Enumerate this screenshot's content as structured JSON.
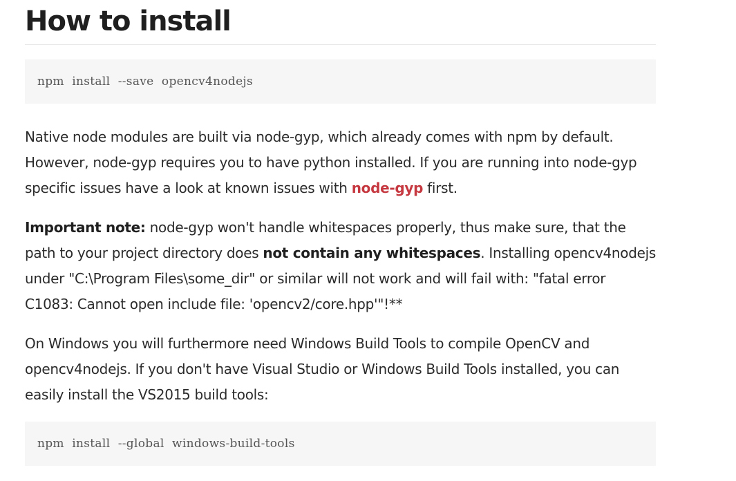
{
  "heading": "How to install",
  "code_blocks": [
    "npm  install  --save  opencv4nodejs",
    "npm  install  --global  windows-build-tools"
  ],
  "paragraphs": {
    "p1": {
      "before_link": "Native node modules are built via node-gyp, which already comes with npm by default. However, node-gyp requires you to have python installed. If you are running into node-gyp specific issues have a look at known issues with ",
      "link": "node-gyp",
      "after_link": " first."
    },
    "p2": {
      "bold_label": "Important note:",
      "text_1": " node-gyp won't handle whitespaces properly, thus make sure, that the path to your project directory does ",
      "bold_emphasis": "not contain any whitespaces",
      "text_2": ". Installing opencv4nodejs under \"C:\\Program Files\\some_dir\" or similar will not work and will fail with: \"fatal error C1083: Cannot open include file: 'opencv2/core.hpp'\"!**"
    },
    "p3": {
      "text": "On Windows you will furthermore need Windows Build Tools to compile OpenCV and opencv4nodejs. If you don't have Visual Studio or Windows Build Tools installed, you can easily install the VS2015 build tools:"
    }
  },
  "colors": {
    "link": "#c6383f",
    "code_background": "#f6f6f6",
    "text": "#2b2b2b"
  }
}
